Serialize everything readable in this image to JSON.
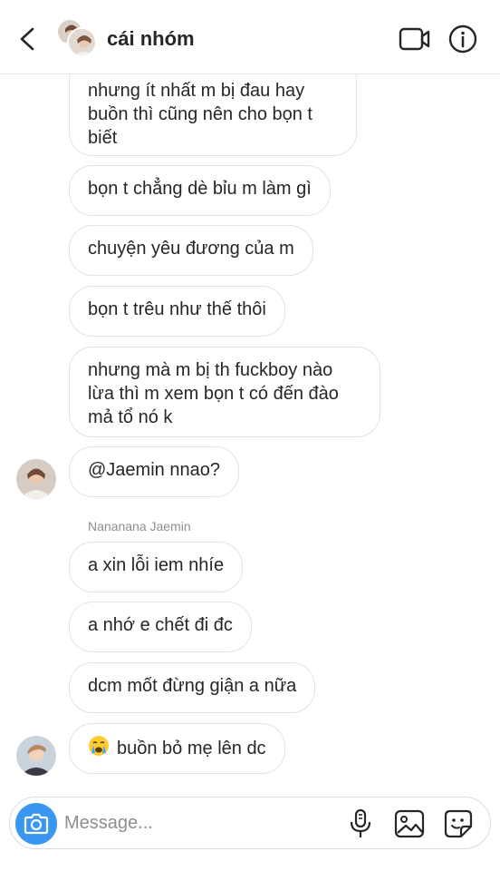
{
  "header": {
    "title": "cái nhóm"
  },
  "messages": [
    {
      "text": "nhưng ít nhất m bị đau hay buồn thì cũng nên cho bọn t biết"
    },
    {
      "text": "bọn t chẳng dè bỉu m làm gì"
    },
    {
      "text": "chuyện yêu đương của m"
    },
    {
      "text": "bọn t trêu như thế thôi"
    },
    {
      "text": "nhưng mà m bị th fuckboy nào lừa thì m xem bọn t có đến đào mả tổ nó k"
    },
    {
      "text": "@Jaemin nnao?"
    },
    {
      "text": "a xin lỗi iem nhíe"
    },
    {
      "text": "a nhớ e chết đi đc"
    },
    {
      "text": "dcm mốt đừng giận a nữa"
    },
    {
      "text": "buồn bỏ mẹ lên dc",
      "emoji": "crying-face"
    }
  ],
  "sender_label": "Nananana Jaemin",
  "composer": {
    "placeholder": "Message..."
  },
  "icons": {
    "back": "chevron-left-icon",
    "video": "video-camera-icon",
    "info": "info-icon",
    "camera": "camera-icon",
    "mic": "microphone-icon",
    "gallery": "image-icon",
    "sticker": "sticker-icon"
  },
  "colors": {
    "accent": "#3897f0",
    "bubble_border": "#e3e3e3",
    "text": "#262626",
    "muted": "#8e8e8e"
  }
}
